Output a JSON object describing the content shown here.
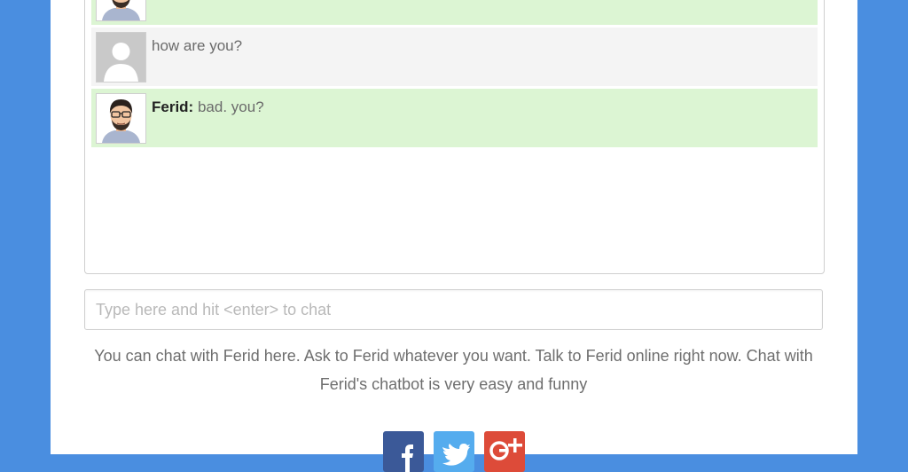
{
  "chat": {
    "messages": [
      {
        "role": "bot",
        "sender": "",
        "text": ""
      },
      {
        "role": "user",
        "sender": "",
        "text": "how are you?"
      },
      {
        "role": "bot",
        "sender": "Ferid:",
        "text": "bad. you?"
      }
    ]
  },
  "input": {
    "placeholder": "Type here and hit <enter> to chat",
    "value": ""
  },
  "description": "You can chat with Ferid here. Ask to Ferid whatever you want. Talk to Ferid online right now. Chat with Ferid's chatbot is very easy and funny",
  "share": {
    "icons": [
      "facebook-icon",
      "twitter-icon",
      "google-plus-icon"
    ]
  },
  "colors": {
    "background": "#4a8ee0",
    "bot_message_bg": "#dcf5d3",
    "user_message_bg": "#f4f4f4",
    "facebook": "#3b5998",
    "twitter": "#55acee",
    "google_plus": "#dd4b39"
  }
}
